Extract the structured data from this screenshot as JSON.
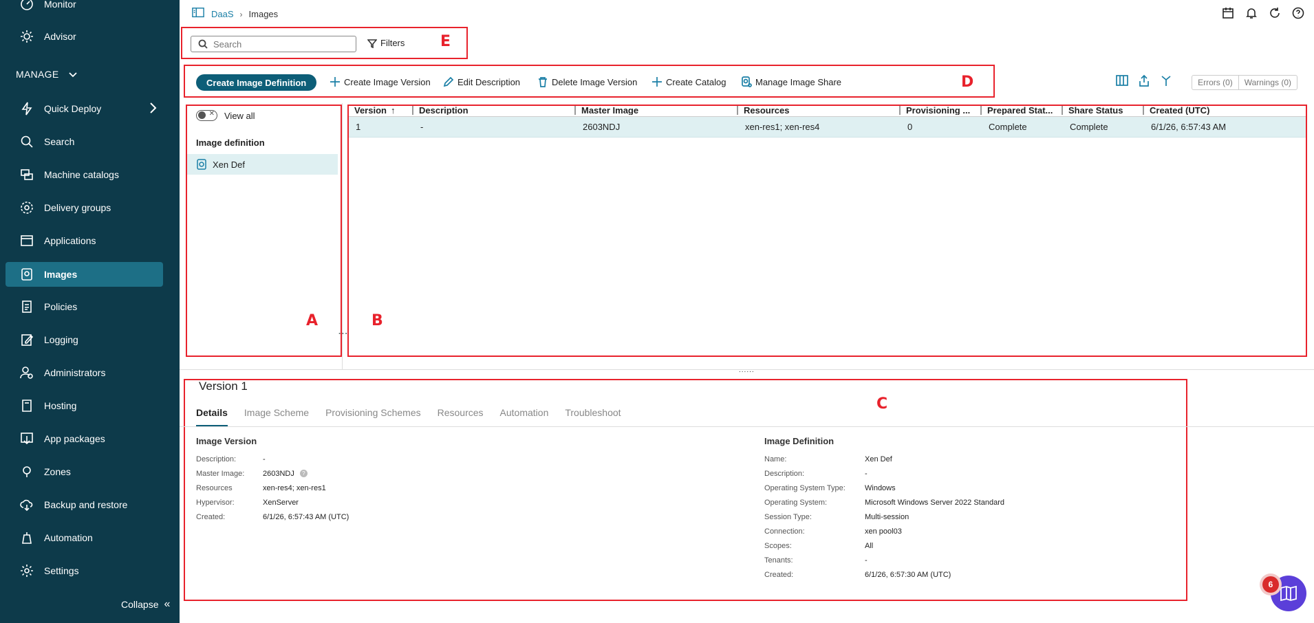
{
  "sidebar": {
    "top_items": [
      {
        "label": "Monitor",
        "icon": "gauge-icon"
      },
      {
        "label": "Advisor",
        "icon": "sun-icon"
      }
    ],
    "manage_label": "MANAGE",
    "items": [
      {
        "label": "Quick Deploy",
        "icon": "lightning-icon"
      },
      {
        "label": "Search",
        "icon": "search-icon"
      },
      {
        "label": "Machine catalogs",
        "icon": "machine-catalog-icon"
      },
      {
        "label": "Delivery groups",
        "icon": "delivery-group-icon"
      },
      {
        "label": "Applications",
        "icon": "application-icon"
      },
      {
        "label": "Images",
        "icon": "image-icon"
      },
      {
        "label": "Policies",
        "icon": "policy-icon"
      },
      {
        "label": "Logging",
        "icon": "logging-icon"
      },
      {
        "label": "Administrators",
        "icon": "administrators-icon"
      },
      {
        "label": "Hosting",
        "icon": "hosting-icon"
      },
      {
        "label": "App packages",
        "icon": "app-packages-icon"
      },
      {
        "label": "Zones",
        "icon": "zones-icon"
      },
      {
        "label": "Backup and restore",
        "icon": "backup-icon"
      },
      {
        "label": "Automation",
        "icon": "automation-icon"
      },
      {
        "label": "Settings",
        "icon": "gear-icon"
      }
    ],
    "active": "Images",
    "collapse_label": "Collapse"
  },
  "breadcrumb": {
    "parent": "DaaS",
    "current": "Images"
  },
  "search": {
    "placeholder": "Search",
    "value": ""
  },
  "filters_label": "Filters",
  "toolbar": {
    "create_definition": "Create Image Definition",
    "create_version": "Create Image Version",
    "edit_description": "Edit Description",
    "delete_version": "Delete Image Version",
    "create_catalog": "Create Catalog",
    "manage_share": "Manage Image Share",
    "errors": "Errors (0)",
    "warnings": "Warnings (0)"
  },
  "left_panel": {
    "view_all": "View all",
    "heading": "Image definition",
    "items": [
      "Xen Def"
    ]
  },
  "table": {
    "columns": [
      "Version",
      "Description",
      "Master Image",
      "Resources",
      "Provisioning ...",
      "Prepared Stat...",
      "Share Status",
      "Created (UTC)"
    ],
    "rows": [
      [
        "1",
        "-",
        "2603NDJ",
        "xen-res1; xen-res4",
        "0",
        "Complete",
        "Complete",
        "6/1/26, 6:57:43 AM"
      ]
    ]
  },
  "details": {
    "title": "Version 1",
    "tabs": [
      "Details",
      "Image Scheme",
      "Provisioning Schemes",
      "Resources",
      "Automation",
      "Troubleshoot"
    ],
    "active_tab": "Details",
    "image_version": {
      "heading": "Image Version",
      "fields": [
        {
          "k": "Description:",
          "v": "-"
        },
        {
          "k": "Master Image:",
          "v": "2603NDJ"
        },
        {
          "k": "Resources",
          "v": "xen-res4; xen-res1"
        },
        {
          "k": "Hypervisor:",
          "v": "XenServer"
        },
        {
          "k": "Created:",
          "v": "6/1/26, 6:57:43 AM (UTC)"
        }
      ]
    },
    "image_definition": {
      "heading": "Image Definition",
      "fields": [
        {
          "k": "Name:",
          "v": "Xen Def"
        },
        {
          "k": "Description:",
          "v": "-"
        },
        {
          "k": "Operating System Type:",
          "v": "Windows"
        },
        {
          "k": "Operating System:",
          "v": "Microsoft Windows Server 2022 Standard"
        },
        {
          "k": "Session Type:",
          "v": "Multi-session"
        },
        {
          "k": "Connection:",
          "v": "xen pool03"
        },
        {
          "k": "Scopes:",
          "v": "All"
        },
        {
          "k": "Tenants:",
          "v": "-"
        },
        {
          "k": "Created:",
          "v": "6/1/26, 6:57:30 AM (UTC)"
        }
      ]
    }
  },
  "annotations": {
    "A": "A",
    "B": "B",
    "C": "C",
    "D": "D",
    "E": "E"
  },
  "chat": {
    "count": "6"
  },
  "colors": {
    "sidebar_bg": "#0d3a4a",
    "active_item": "#1d6f86",
    "accent": "#0d5e78",
    "annotation_red": "#e8222c",
    "selected_row": "#dff0f2"
  }
}
